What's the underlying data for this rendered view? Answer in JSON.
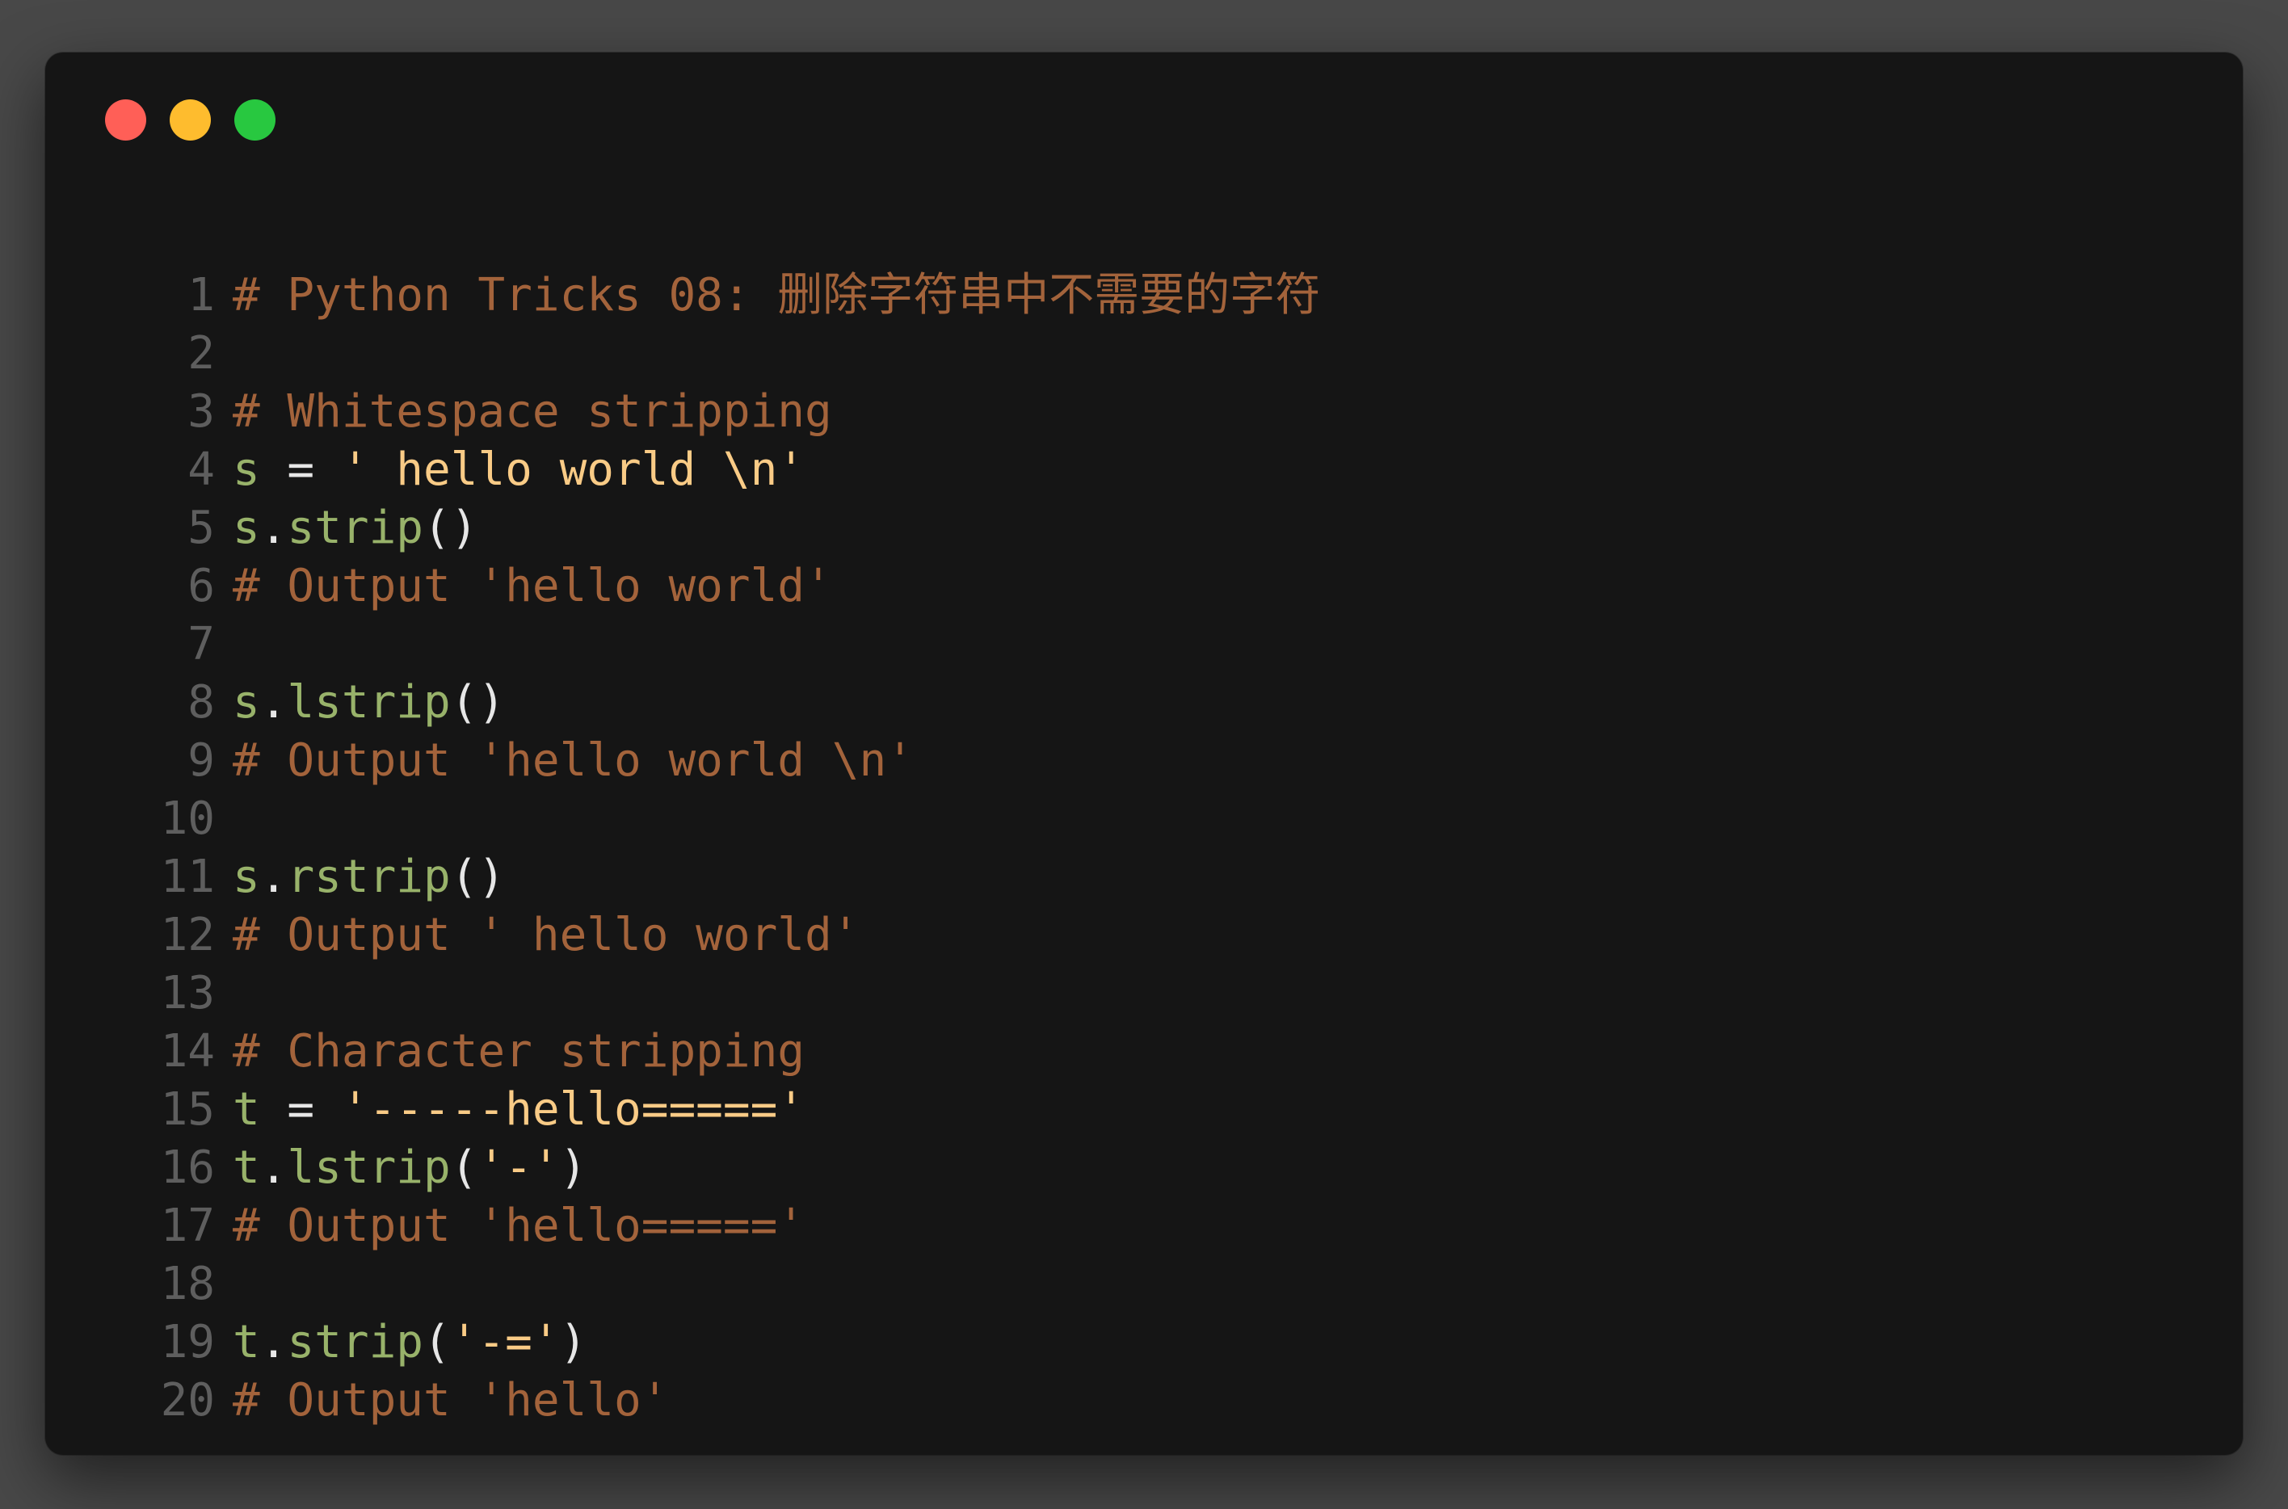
{
  "window": {
    "controls": [
      "close",
      "minimize",
      "maximize"
    ],
    "colors": {
      "background": "#151515",
      "close": "#ff5f57",
      "minimize": "#febc2e",
      "maximize": "#28c840"
    }
  },
  "code": {
    "language": "python",
    "lines": [
      {
        "n": "1",
        "tokens": [
          {
            "t": "# Python Tricks 08: 删除字符串中不需要的字符",
            "k": "comment"
          }
        ]
      },
      {
        "n": "2",
        "tokens": []
      },
      {
        "n": "3",
        "tokens": [
          {
            "t": "# Whitespace stripping",
            "k": "comment"
          }
        ]
      },
      {
        "n": "4",
        "tokens": [
          {
            "t": "s",
            "k": "var"
          },
          {
            "t": " = ",
            "k": "op"
          },
          {
            "t": "' hello world \\n'",
            "k": "str"
          }
        ]
      },
      {
        "n": "5",
        "tokens": [
          {
            "t": "s",
            "k": "var"
          },
          {
            "t": ".",
            "k": "punc"
          },
          {
            "t": "strip",
            "k": "fn"
          },
          {
            "t": "()",
            "k": "punc"
          }
        ]
      },
      {
        "n": "6",
        "tokens": [
          {
            "t": "# Output 'hello world'",
            "k": "comment"
          }
        ]
      },
      {
        "n": "7",
        "tokens": []
      },
      {
        "n": "8",
        "tokens": [
          {
            "t": "s",
            "k": "var"
          },
          {
            "t": ".",
            "k": "punc"
          },
          {
            "t": "lstrip",
            "k": "fn"
          },
          {
            "t": "()",
            "k": "punc"
          }
        ]
      },
      {
        "n": "9",
        "tokens": [
          {
            "t": "# Output 'hello world \\n'",
            "k": "comment"
          }
        ]
      },
      {
        "n": "10",
        "tokens": []
      },
      {
        "n": "11",
        "tokens": [
          {
            "t": "s",
            "k": "var"
          },
          {
            "t": ".",
            "k": "punc"
          },
          {
            "t": "rstrip",
            "k": "fn"
          },
          {
            "t": "()",
            "k": "punc"
          }
        ]
      },
      {
        "n": "12",
        "tokens": [
          {
            "t": "# Output ' hello world'",
            "k": "comment"
          }
        ]
      },
      {
        "n": "13",
        "tokens": []
      },
      {
        "n": "14",
        "tokens": [
          {
            "t": "# Character stripping",
            "k": "comment"
          }
        ]
      },
      {
        "n": "15",
        "tokens": [
          {
            "t": "t",
            "k": "var"
          },
          {
            "t": " = ",
            "k": "op"
          },
          {
            "t": "'-----hello====='",
            "k": "str"
          }
        ]
      },
      {
        "n": "16",
        "tokens": [
          {
            "t": "t",
            "k": "var"
          },
          {
            "t": ".",
            "k": "punc"
          },
          {
            "t": "lstrip",
            "k": "fn"
          },
          {
            "t": "(",
            "k": "punc"
          },
          {
            "t": "'-'",
            "k": "str"
          },
          {
            "t": ")",
            "k": "punc"
          }
        ]
      },
      {
        "n": "17",
        "tokens": [
          {
            "t": "# Output 'hello====='",
            "k": "comment"
          }
        ]
      },
      {
        "n": "18",
        "tokens": []
      },
      {
        "n": "19",
        "tokens": [
          {
            "t": "t",
            "k": "var"
          },
          {
            "t": ".",
            "k": "punc"
          },
          {
            "t": "strip",
            "k": "fn"
          },
          {
            "t": "(",
            "k": "punc"
          },
          {
            "t": "'-='",
            "k": "str"
          },
          {
            "t": ")",
            "k": "punc"
          }
        ]
      },
      {
        "n": "20",
        "tokens": [
          {
            "t": "# Output 'hello'",
            "k": "comment"
          }
        ]
      }
    ]
  }
}
